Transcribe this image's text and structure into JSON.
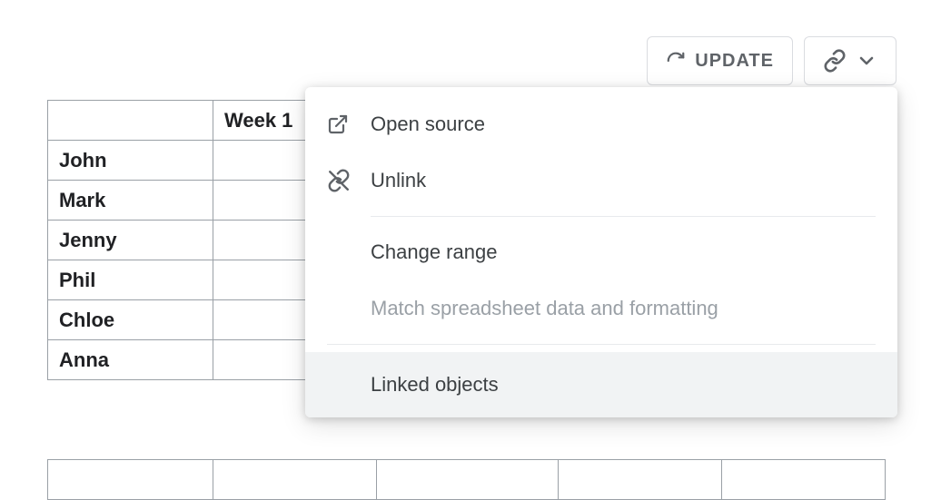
{
  "toolbar": {
    "update_label": "UPDATE"
  },
  "table": {
    "headers": [
      "",
      "Week 1"
    ],
    "rows": [
      "John",
      "Mark",
      "Jenny",
      "Phil",
      "Chloe",
      "Anna"
    ]
  },
  "menu": {
    "open_source": "Open source",
    "unlink": "Unlink",
    "change_range": "Change range",
    "match_formatting": "Match spreadsheet data and formatting",
    "linked_objects": "Linked objects"
  }
}
